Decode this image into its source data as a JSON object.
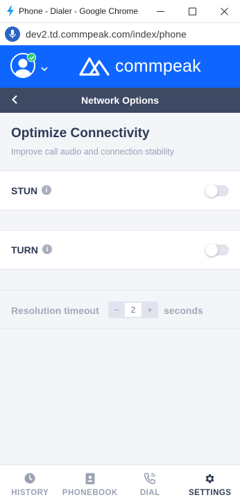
{
  "window": {
    "title": "Phone - Dialer - Google Chrome",
    "url": "dev2.td.commpeak.com/index/phone"
  },
  "header": {
    "brand": "commpeak",
    "accent_color": "#0e66ff",
    "online_status_color": "#2ccb6f"
  },
  "subheader": {
    "title": "Network Options"
  },
  "intro": {
    "title": "Optimize Connectivity",
    "subtitle": "Improve call audio and connection stability"
  },
  "settings": {
    "stun": {
      "label": "STUN",
      "enabled": false
    },
    "turn": {
      "label": "TURN",
      "enabled": false
    },
    "timeout": {
      "label": "Resolution timeout",
      "value": "2",
      "minus": "−",
      "plus": "+",
      "unit": "seconds"
    }
  },
  "nav": {
    "history": "HISTORY",
    "phonebook": "PHONEBOOK",
    "dial": "DIAL",
    "settings": "SETTINGS",
    "active": "settings"
  },
  "icons": {
    "app": "bolt-icon",
    "minimize": "minimize-icon",
    "maximize": "maximize-icon",
    "close": "close-icon",
    "mic": "microphone-icon",
    "back": "chevron-left-icon",
    "info": "info-icon"
  }
}
